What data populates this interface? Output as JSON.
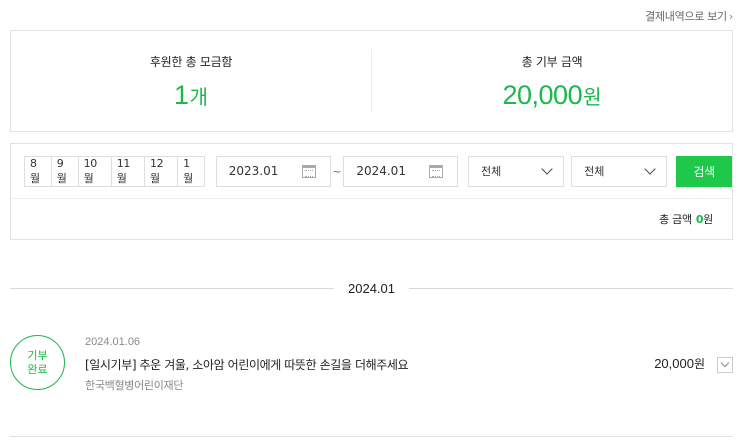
{
  "header": {
    "payment_link_label": "결제내역으로 보기",
    "payment_link_icon": "chevron-right-icon"
  },
  "summary": {
    "count_label": "후원한 총 모금함",
    "count_value": "1",
    "count_unit": "개",
    "amount_label": "총 기부 금액",
    "amount_value": "20,000",
    "amount_unit": "원",
    "accent_color": "#1bb84a"
  },
  "filter": {
    "months": [
      "8월",
      "9월",
      "10월",
      "11월",
      "12월",
      "1월"
    ],
    "start_date": "2023.01",
    "end_date": "2024.01",
    "range_separator": "~",
    "date_icon": "calendar-icon",
    "select_1_value": "전체",
    "select_2_value": "전체",
    "search_label": "검색",
    "search_color": "#1ec84b",
    "total_label": "총 금액",
    "total_value": "0",
    "total_unit": "원"
  },
  "section": {
    "period_label": "2024.01"
  },
  "items": [
    {
      "badge_line1": "기부",
      "badge_line2": "완료",
      "date": "2024.01.06",
      "title": "[일시기부] 추운 겨울, 소아암 어린이에게 따뜻한 손길을 더해주세요",
      "organization": "한국백혈병어린이재단",
      "amount_value": "20,000",
      "amount_unit": "원",
      "toggle_icon": "chevron-down-icon"
    }
  ]
}
